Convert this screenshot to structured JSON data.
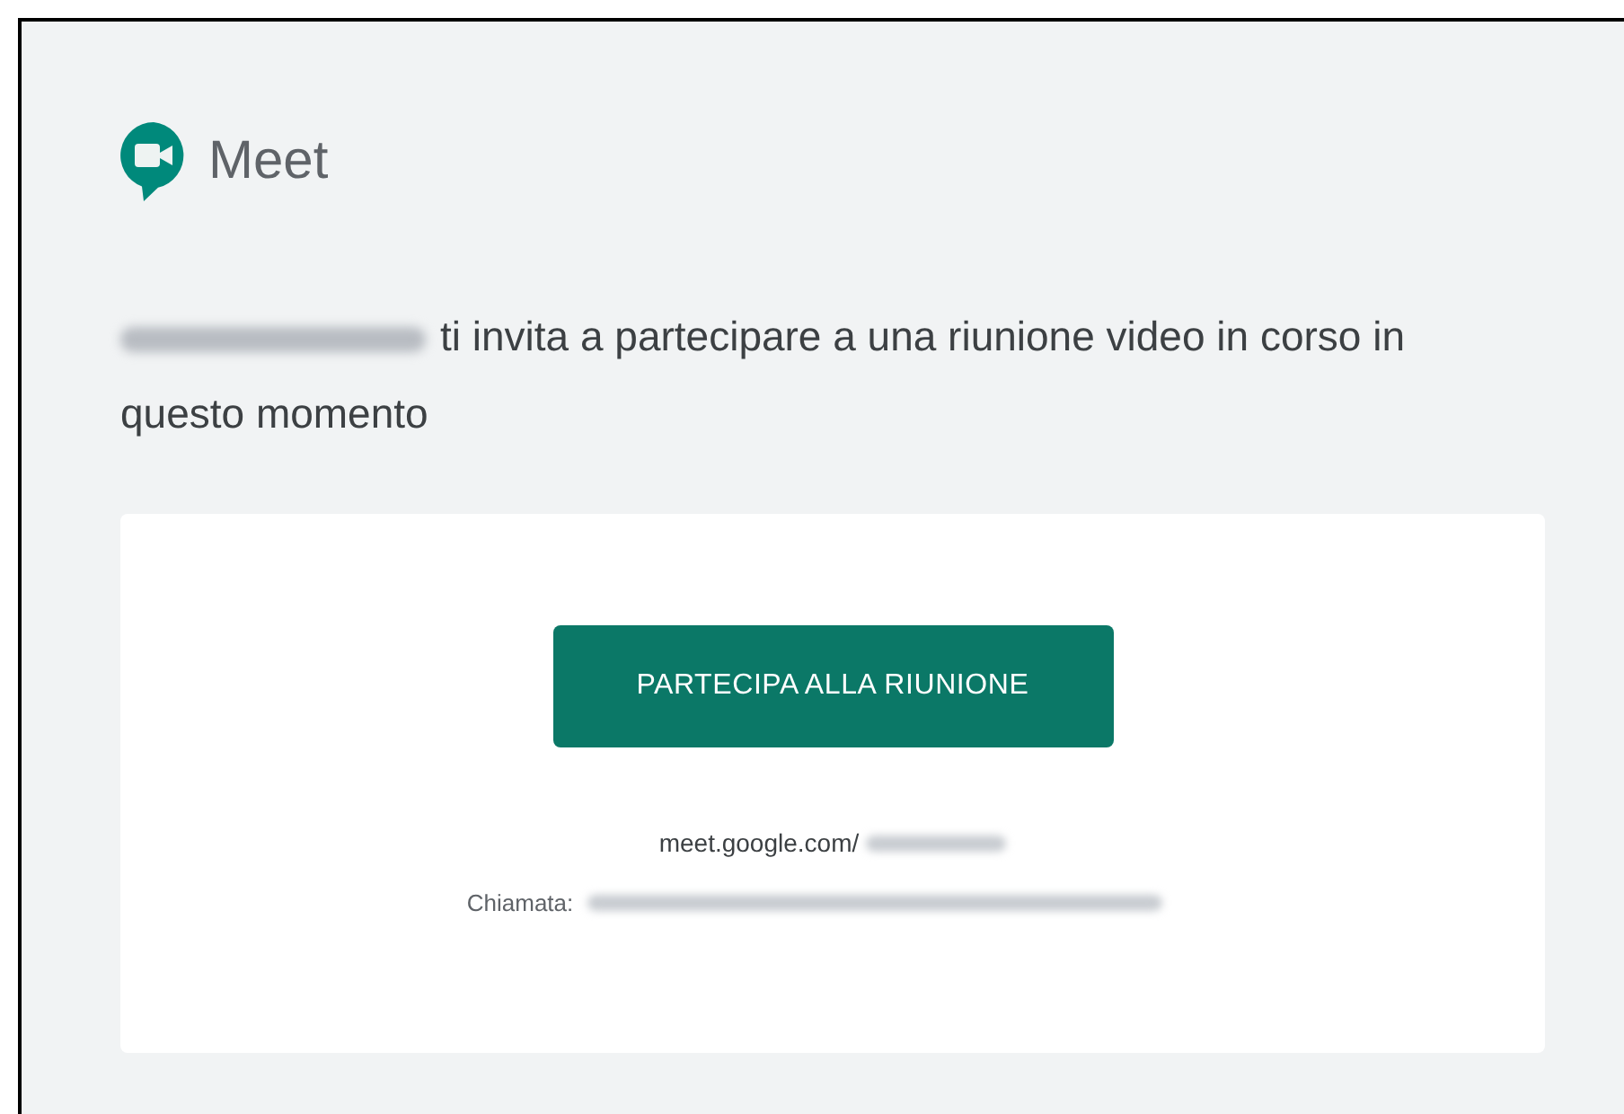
{
  "app": {
    "name": "Meet"
  },
  "invitation": {
    "message": "ti invita a partecipare a una riunione video in corso in questo momento"
  },
  "card": {
    "join_button": "PARTECIPA ALLA RIUNIONE",
    "link": "meet.google.com/",
    "phone_label": "Chiamata:"
  }
}
